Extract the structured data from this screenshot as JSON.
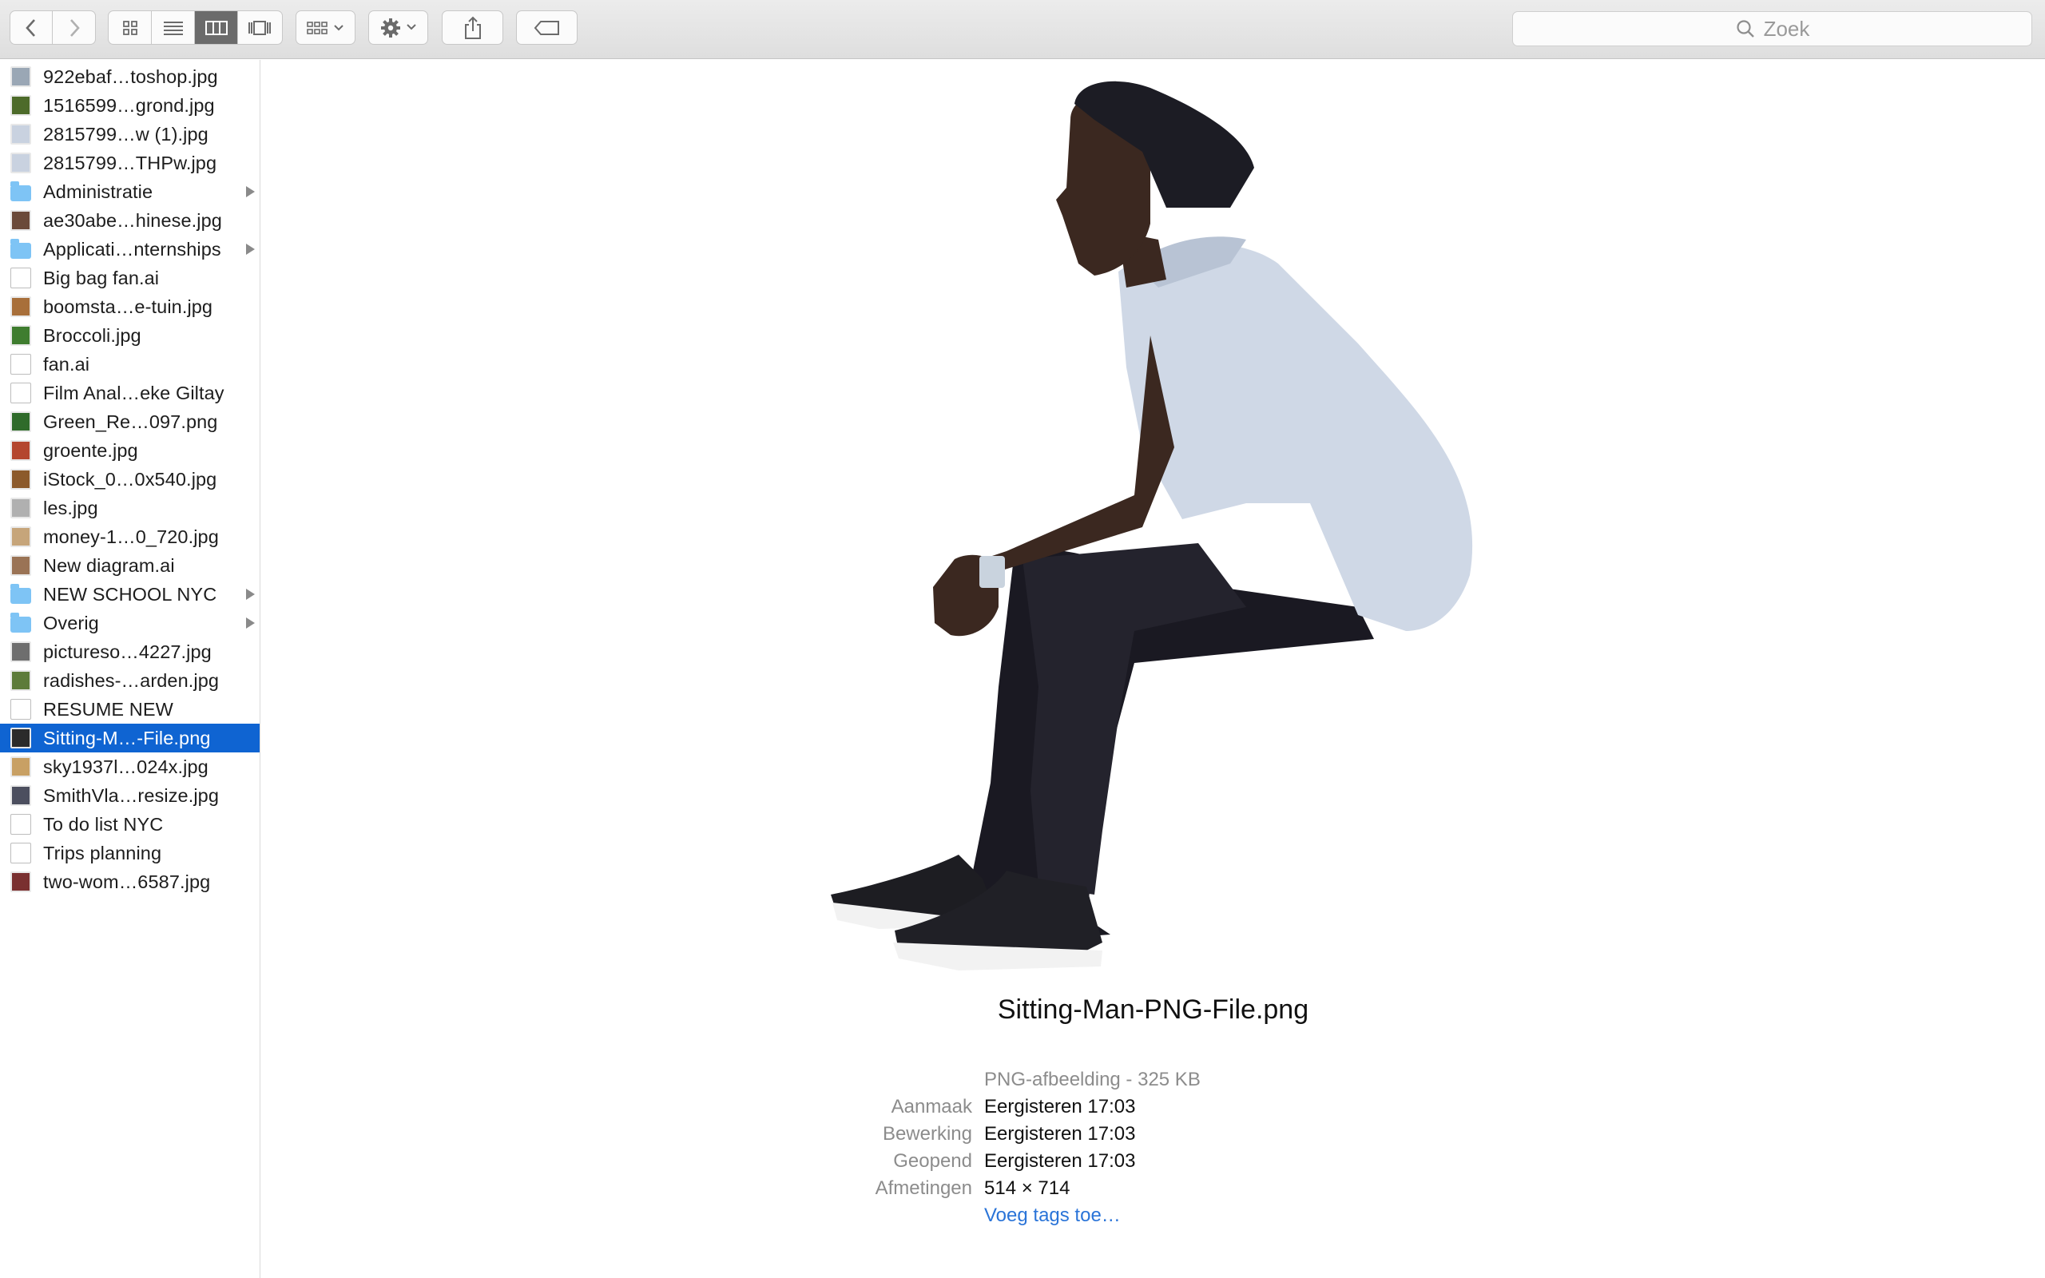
{
  "search": {
    "placeholder": "Zoek"
  },
  "files": [
    {
      "name": "922ebaf…toshop.jpg",
      "kind": "img",
      "color": "#9aa7b5"
    },
    {
      "name": "1516599…grond.jpg",
      "kind": "img",
      "color": "#4d6b2a"
    },
    {
      "name": "2815799…w (1).jpg",
      "kind": "img",
      "color": "#c9d2e0"
    },
    {
      "name": "2815799…THPw.jpg",
      "kind": "img",
      "color": "#c9d2e0"
    },
    {
      "name": "Administratie",
      "kind": "folder",
      "color": "#7ec4f5"
    },
    {
      "name": "ae30abe…hinese.jpg",
      "kind": "img",
      "color": "#6b4a3a"
    },
    {
      "name": "Applicati…nternships",
      "kind": "folder",
      "color": "#7ec4f5"
    },
    {
      "name": "Big bag fan.ai",
      "kind": "doc",
      "color": "#ffffff"
    },
    {
      "name": "boomsta…e-tuin.jpg",
      "kind": "img",
      "color": "#a86f3a"
    },
    {
      "name": "Broccoli.jpg",
      "kind": "img",
      "color": "#3f7d2f"
    },
    {
      "name": "fan.ai",
      "kind": "doc",
      "color": "#ffffff"
    },
    {
      "name": "Film Anal…eke Giltay",
      "kind": "doc",
      "color": "#ffffff"
    },
    {
      "name": "Green_Re…097.png",
      "kind": "img",
      "color": "#2f6b2a"
    },
    {
      "name": "groente.jpg",
      "kind": "img",
      "color": "#b4462e"
    },
    {
      "name": "iStock_0…0x540.jpg",
      "kind": "img",
      "color": "#8c5a2b"
    },
    {
      "name": "les.jpg",
      "kind": "img",
      "color": "#b0b0b0"
    },
    {
      "name": "money-1…0_720.jpg",
      "kind": "img",
      "color": "#c6a57a"
    },
    {
      "name": "New diagram.ai",
      "kind": "img",
      "color": "#9a7355"
    },
    {
      "name": "NEW SCHOOL NYC",
      "kind": "folder",
      "color": "#7ec4f5"
    },
    {
      "name": "Overig",
      "kind": "folder",
      "color": "#7ec4f5"
    },
    {
      "name": "pictureso…4227.jpg",
      "kind": "img",
      "color": "#6e6e6e"
    },
    {
      "name": "radishes-…arden.jpg",
      "kind": "img",
      "color": "#5d7b3a"
    },
    {
      "name": "RESUME NEW",
      "kind": "doc",
      "color": "#ffffff"
    },
    {
      "name": "Sitting-M…-File.png",
      "kind": "img",
      "color": "#2b2b2b"
    },
    {
      "name": "sky1937l…024x.jpg",
      "kind": "img",
      "color": "#c8a064"
    },
    {
      "name": "SmithVla…resize.jpg",
      "kind": "img",
      "color": "#4c4f5f"
    },
    {
      "name": "To do list NYC",
      "kind": "doc",
      "color": "#ffffff"
    },
    {
      "name": "Trips planning",
      "kind": "doc",
      "color": "#ffffff"
    },
    {
      "name": "two-wom…6587.jpg",
      "kind": "img",
      "color": "#7a3030"
    }
  ],
  "selected_index": 23,
  "preview": {
    "filename": "Sitting-Man-PNG-File.png",
    "kind": "PNG-afbeelding - 325 KB",
    "rows": [
      {
        "label": "Aanmaak",
        "value": "Eergisteren 17:03"
      },
      {
        "label": "Bewerking",
        "value": "Eergisteren 17:03"
      },
      {
        "label": "Geopend",
        "value": "Eergisteren 17:03"
      },
      {
        "label": "Afmetingen",
        "value": "514 × 714"
      }
    ],
    "tags_link": "Voeg tags toe…"
  },
  "colors": {
    "selection": "#0f64d2",
    "link": "#2a74d8",
    "folder": "#7ec4f5"
  }
}
